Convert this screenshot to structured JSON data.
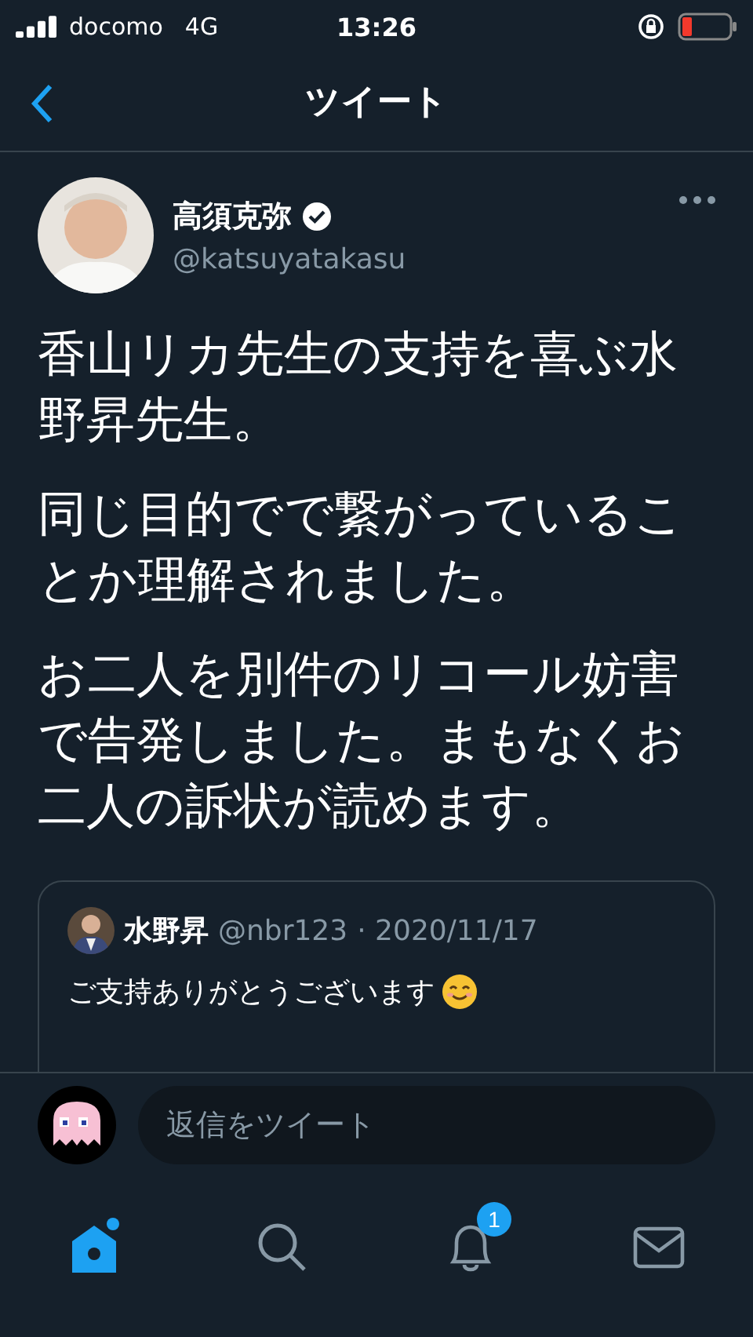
{
  "status_bar": {
    "carrier": "docomo",
    "network": "4G",
    "time": "13:26"
  },
  "header": {
    "title": "ツイート"
  },
  "tweet": {
    "author": {
      "name": "高須克弥",
      "handle": "@katsuyatakasu",
      "verified": true
    },
    "paragraphs": [
      "香山リカ先生の支持を喜ぶ水野昇先生。",
      "同じ目的でで繋がっていることか理解されました。",
      "お二人を別件のリコール妨害で告発しました。まもなくお二人の訴状が読めます。"
    ],
    "quote": {
      "name": "水野昇",
      "handle": "@nbr123",
      "date": "· 2020/11/17",
      "text": "ご支持ありがとうございます"
    }
  },
  "reply": {
    "placeholder": "返信をツイート"
  },
  "tab_bar": [
    {
      "kind": "home",
      "selected": true
    },
    {
      "kind": "search",
      "selected": false
    },
    {
      "kind": "notifications",
      "selected": false,
      "badge": "1"
    },
    {
      "kind": "messages",
      "selected": false
    }
  ]
}
